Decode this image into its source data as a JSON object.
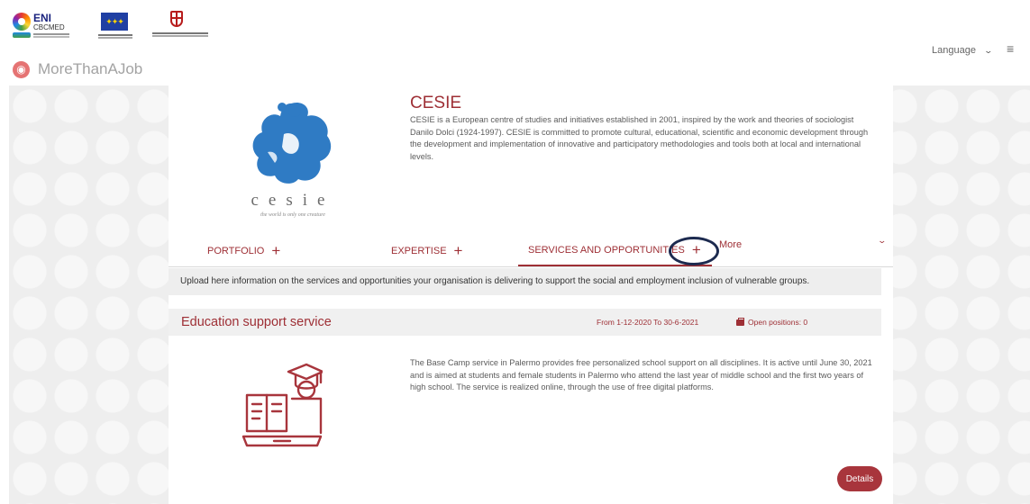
{
  "header": {
    "logos": [
      {
        "name": "eni-cbcmed-logo",
        "title": "ENI",
        "subtitle": "CBCMED"
      },
      {
        "name": "eu-flag-logo"
      },
      {
        "name": "sardinia-region-logo"
      }
    ],
    "brand": "MoreThanAJob",
    "language_label": "Language",
    "language_chevron": "⌄",
    "menu_glyph": "≡"
  },
  "org": {
    "name": "CESIE",
    "logo_word": "cesie",
    "logo_tagline": "the world is only one creature",
    "description": "CESIE is a European centre of studies and initiatives established in 2001, inspired by the work and theories of sociologist Danilo Dolci (1924-1997). CESIE is committed to promote cultural, educational, scientific and economic development through the development and implementation of innovative and participatory methodologies and tools both at local and international levels."
  },
  "tabs": {
    "items": [
      {
        "label": "PORTFOLIO",
        "plus": "+"
      },
      {
        "label": "EXPERTISE",
        "plus": "+"
      },
      {
        "label": "SERVICES AND OPPORTUNITIES",
        "plus": "+",
        "active": true
      }
    ],
    "more_label": "More",
    "chevron": "⌄"
  },
  "notice": "Upload here information on the services and opportunities your organisation is delivering to support the social and employment inclusion of vulnerable groups.",
  "service": {
    "title": "Education support service",
    "dates": "From 1-12-2020 To 30-6-2021",
    "positions": "Open positions: 0",
    "description": "The Base Camp service in Palermo provides free personalized school support on all disciplines. It is active until June 30, 2021 and is aimed at students and female students in Palermo who attend the last year of middle school and the first two years of high school. The service is realized online, through the use of free digital platforms.",
    "details_label": "Details"
  },
  "colors": {
    "accent": "#9e2f35",
    "button": "#a8353c",
    "highlight_ring": "#1c2a4f",
    "background": "#eeeeee"
  }
}
